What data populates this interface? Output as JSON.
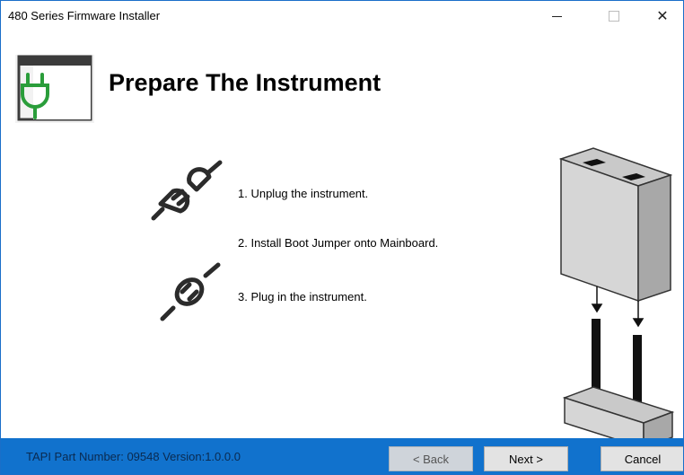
{
  "window": {
    "title": "480 Series Firmware Installer",
    "minimize_symbol": "",
    "close_symbol": "✕"
  },
  "header": {
    "title": "Prepare The Instrument",
    "icon": "plug-window-icon"
  },
  "steps": [
    {
      "text": "1. Unplug the instrument.",
      "icon": "unplugged-icon"
    },
    {
      "text": "2. Install Boot Jumper onto Mainboard.",
      "icon": ""
    },
    {
      "text": "3. Plug in the instrument.",
      "icon": "plugged-icon"
    }
  ],
  "illustration": {
    "icon": "boot-jumper-illustration"
  },
  "footer": {
    "part_number": "TAPI Part Number: 09548  Version:1.0.0.0",
    "back_label": "< Back",
    "next_label": "Next >",
    "cancel_label": "Cancel"
  },
  "colors": {
    "footer_bg": "#1172cd",
    "accent_green": "#2a9d3a",
    "window_border": "#1a6fc9"
  }
}
